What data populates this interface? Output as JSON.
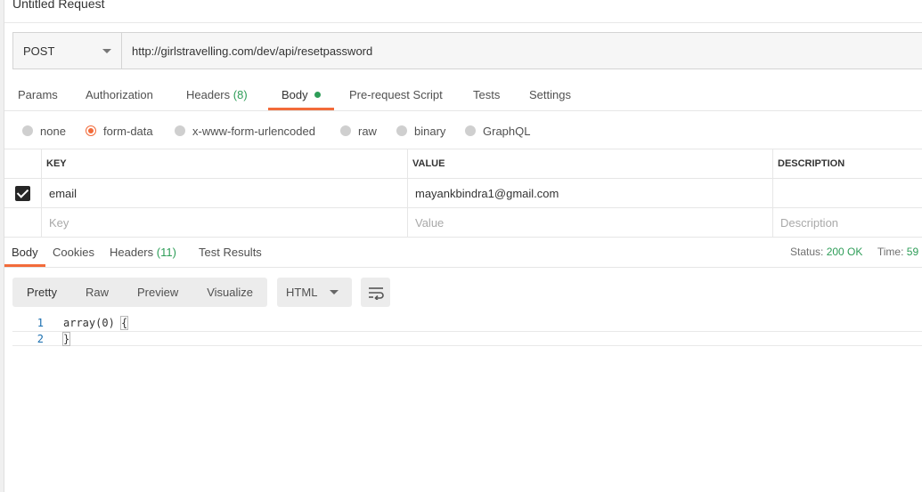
{
  "request": {
    "title": "Untitled Request",
    "method": "POST",
    "url": "http://girlstravelling.com/dev/api/resetpassword"
  },
  "request_tabs": [
    {
      "label": "Params"
    },
    {
      "label": "Authorization"
    },
    {
      "label": "Headers",
      "count": "(8)"
    },
    {
      "label": "Body"
    },
    {
      "label": "Pre-request Script"
    },
    {
      "label": "Tests"
    },
    {
      "label": "Settings"
    }
  ],
  "body_types": [
    {
      "label": "none"
    },
    {
      "label": "form-data"
    },
    {
      "label": "x-www-form-urlencoded"
    },
    {
      "label": "raw"
    },
    {
      "label": "binary"
    },
    {
      "label": "GraphQL"
    }
  ],
  "form_table": {
    "headers": {
      "key": "KEY",
      "value": "VALUE",
      "description": "DESCRIPTION"
    },
    "rows": [
      {
        "key": "email",
        "value": "mayankbindra1@gmail.com",
        "description": ""
      }
    ],
    "placeholders": {
      "key": "Key",
      "value": "Value",
      "description": "Description"
    }
  },
  "response_tabs": [
    {
      "label": "Body"
    },
    {
      "label": "Cookies"
    },
    {
      "label": "Headers",
      "count": "(11)"
    },
    {
      "label": "Test Results"
    }
  ],
  "status": {
    "status_label": "Status:",
    "status_value": "200 OK",
    "time_label": "Time:",
    "time_value": "59"
  },
  "view_modes": [
    "Pretty",
    "Raw",
    "Preview",
    "Visualize"
  ],
  "format": "HTML",
  "code_lines": [
    {
      "num": "1",
      "text": "array(0) "
    },
    {
      "num": "2",
      "text": ""
    }
  ],
  "braces": {
    "open": "{",
    "close": "}"
  },
  "icons": {
    "wrap": "wrap-lines-icon",
    "method_caret": "chevron-down-icon"
  },
  "colors": {
    "accent": "#f26b3a",
    "success": "#2e9d58",
    "line_number": "#1a6fb0"
  }
}
